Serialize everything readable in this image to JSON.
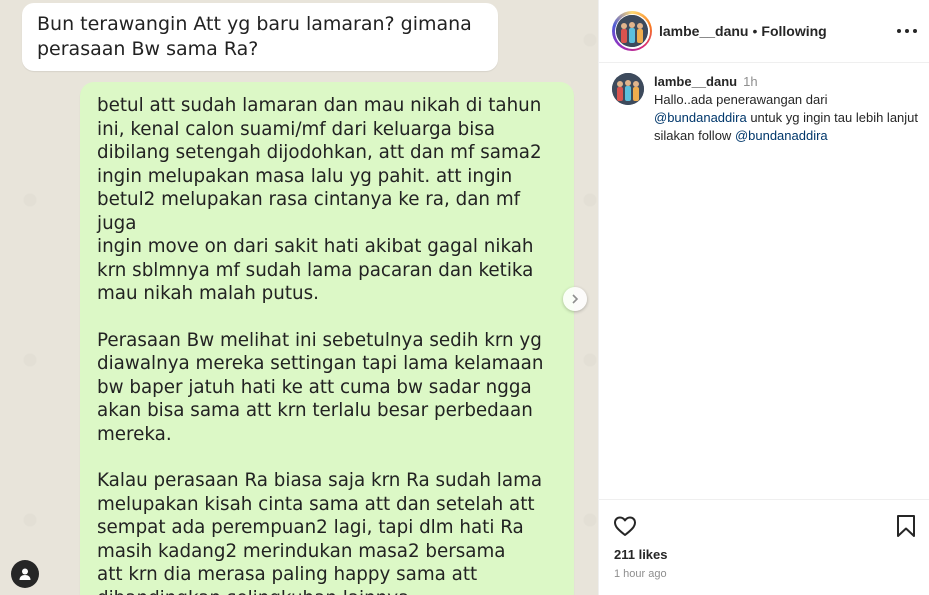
{
  "post_image": {
    "question_message": "Bun terawangin Att yg baru lamaran? gimana perasaan Bw sama Ra?",
    "reply_paragraphs": [
      "betul att sudah lamaran dan mau nikah di tahun\nini, kenal calon suami/mf dari keluarga bisa\ndibilang setengah dijodohkan, att dan mf sama2\ningin melupakan masa lalu yg pahit. att ingin\nbetul2 melupakan rasa cintanya ke ra, dan mf juga\ningin move on dari sakit hati akibat gagal nikah\nkrn sblmnya mf sudah lama pacaran dan ketika\nmau nikah malah putus.",
      "Perasaan Bw melihat ini sebetulnya sedih krn yg\ndiawalnya mereka settingan tapi lama kelamaan\nbw baper jatuh hati ke att cuma bw sadar ngga\nakan bisa sama att krn terlalu besar perbedaan\nmereka.",
      "Kalau perasaan Ra biasa saja krn Ra sudah lama\nmelupakan kisah cinta sama att dan setelah att\nsempat ada perempuan2 lagi, tapi dlm hati Ra\nmasih kadang2 merindukan masa2 bersama\natt krn dia merasa paling happy sama att\ndibandingkan selingkuhan lainnya."
    ],
    "icons": {
      "next": "chevron-right-icon",
      "tags": "user-tag-icon",
      "read_receipt": "double-check-icon"
    }
  },
  "header": {
    "username": "lambe__danu",
    "separator": "•",
    "follow_status": "Following",
    "more_icon": "more-horizontal-icon"
  },
  "caption": {
    "username": "lambe__danu",
    "time": "1h",
    "text_before": "Hallo..ada penerawangan dari ",
    "mention_1": "@bundanaddira",
    "text_middle": " untuk yg ingin tau lebih lanjut silakan follow ",
    "mention_2": "@bundanaddira"
  },
  "actions": {
    "like_icon": "heart-icon",
    "save_icon": "bookmark-icon",
    "likes": "211 likes",
    "time_ago": "1 hour ago"
  },
  "colors": {
    "outgoing_bubble": "#dcf8c6",
    "incoming_bubble": "#ffffff",
    "chat_background": "#e8e4da",
    "mention": "#00376b",
    "muted_text": "#8e8e8e"
  }
}
